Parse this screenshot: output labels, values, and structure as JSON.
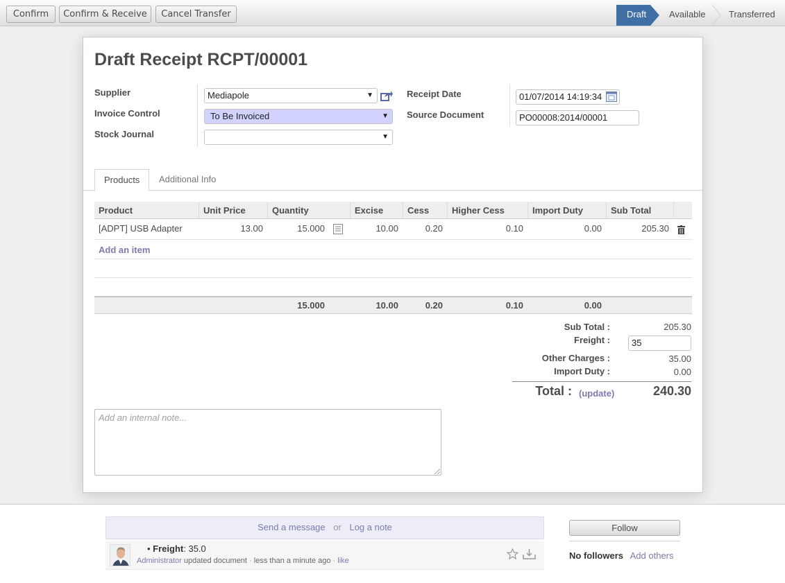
{
  "toolbar": {
    "confirm": "Confirm",
    "confirm_receive": "Confirm & Receive",
    "cancel_transfer": "Cancel Transfer"
  },
  "statusbar": {
    "steps": [
      "Draft",
      "Available",
      "Transferred"
    ],
    "active": "Draft"
  },
  "form": {
    "title": "Draft Receipt RCPT/00001",
    "supplier_label": "Supplier",
    "supplier_value": "Mediapole",
    "invoice_control_label": "Invoice Control",
    "invoice_control_value": "To Be Invoiced",
    "stock_journal_label": "Stock Journal",
    "stock_journal_value": "",
    "receipt_date_label": "Receipt Date",
    "receipt_date_value": "01/07/2014 14:19:34",
    "source_document_label": "Source Document",
    "source_document_value": "PO00008:2014/00001"
  },
  "tabs": [
    "Products",
    "Additional Info"
  ],
  "table": {
    "columns": [
      "Product",
      "Unit Price",
      "Quantity",
      "Excise",
      "Cess",
      "Higher Cess",
      "Import Duty",
      "Sub Total"
    ],
    "rows": [
      {
        "product": "[ADPT] USB Adapter",
        "unit_price": "13.00",
        "quantity": "15.000",
        "excise": "10.00",
        "cess": "0.20",
        "higher_cess": "0.10",
        "import_duty": "0.00",
        "sub_total": "205.30"
      }
    ],
    "add_item": "Add an item",
    "totals": {
      "quantity": "15.000",
      "excise": "10.00",
      "cess": "0.20",
      "higher_cess": "0.10",
      "import_duty": "0.00"
    }
  },
  "summary": {
    "sub_total_label": "Sub Total :",
    "sub_total_value": "205.30",
    "freight_label": "Freight :",
    "freight_value": "35",
    "other_charges_label": "Other Charges :",
    "other_charges_value": "35.00",
    "import_duty_label": "Import Duty :",
    "import_duty_value": "0.00",
    "total_label": "Total :",
    "update_link": "(update)",
    "total_value": "240.30"
  },
  "note": {
    "placeholder": "Add an internal note..."
  },
  "chatter": {
    "send_message": "Send a message",
    "or": "or",
    "log_note": "Log a note",
    "message": {
      "field": "Freight",
      "value": ": 35.0",
      "author": "Administrator",
      "action": "updated document",
      "time": "less than a minute ago",
      "like": "like"
    },
    "follow": "Follow",
    "no_followers": "No followers",
    "add_others": "Add others"
  },
  "colors": {
    "accent": "#3f6fa5",
    "link": "#7c7bad",
    "required": "#d2d2ff"
  }
}
